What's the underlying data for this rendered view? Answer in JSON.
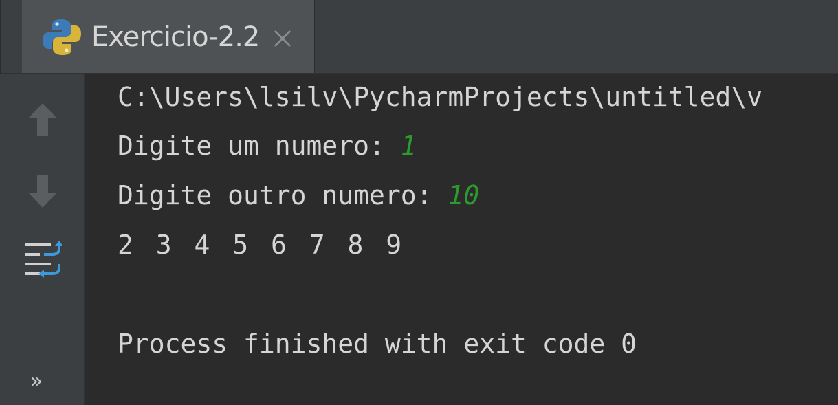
{
  "tab": {
    "title": "Exercicio-2.2",
    "icon": "python-icon"
  },
  "gutter": {
    "up_icon": "arrow-up-icon",
    "down_icon": "arrow-down-icon",
    "wrap_icon": "soft-wrap-icon",
    "more_label": "»"
  },
  "console": {
    "path_line": "C:\\Users\\lsilv\\PycharmProjects\\untitled\\v",
    "prompt1": "Digite um numero: ",
    "input1": "1",
    "prompt2": "Digite outro numero: ",
    "input2": "10",
    "output": "2 3 4 5 6 7 8 9",
    "exit_message": "Process finished with exit code 0"
  },
  "colors": {
    "background": "#2b2b2b",
    "panel": "#3c3f41",
    "text": "#d5d5d5",
    "input": "#2e9a2e",
    "accent_blue": "#3d9ad9"
  }
}
